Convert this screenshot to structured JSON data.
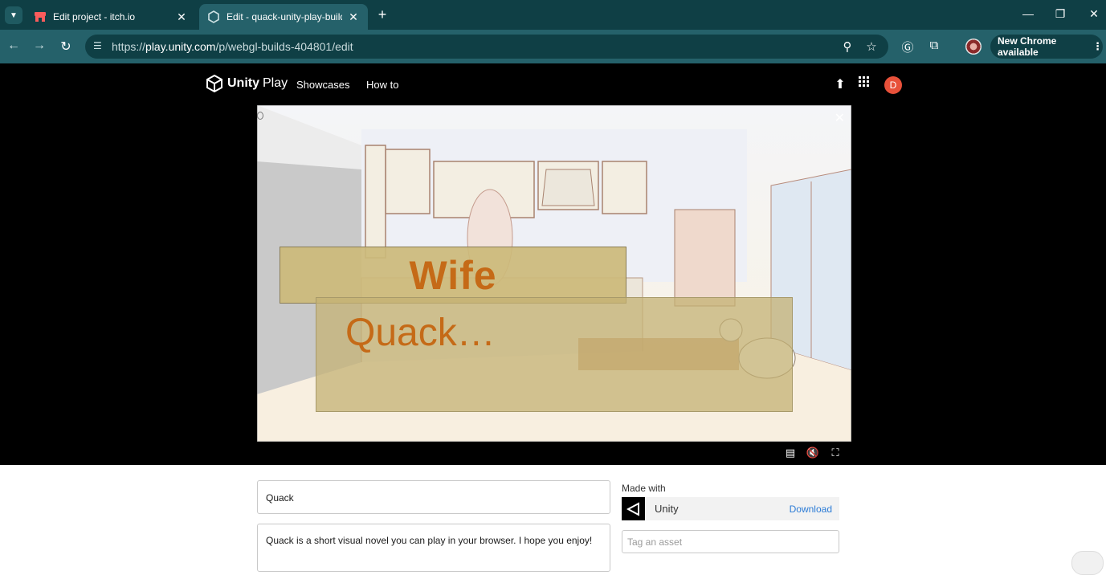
{
  "browser": {
    "tabs": [
      {
        "title": "Edit project - itch.io",
        "active": false
      },
      {
        "title": "Edit - quack-unity-play-build",
        "active": true
      }
    ],
    "url_prefix": "https://",
    "url_host": "play.unity.com",
    "url_path": "/p/webgl-builds-404801/edit",
    "update_button": "New Chrome available",
    "icons": {
      "tab_menu": "chevron-down-icon",
      "new_tab": "plus-icon",
      "minimize": "minimize-icon",
      "restore": "restore-icon",
      "close": "close-icon",
      "back": "arrow-left-icon",
      "forward": "arrow-right-icon",
      "reload": "reload-icon",
      "site_info": "tune-icon",
      "zoom": "zoom-icon",
      "bookmark": "star-icon",
      "grammarly": "grammarly-icon",
      "extensions": "puzzle-icon",
      "menu": "kebab-icon"
    }
  },
  "header": {
    "brand": "Unity",
    "brand_suffix": "Play",
    "nav": [
      "Showcases",
      "How to"
    ],
    "avatar_letter": "D",
    "accent": "#e8513a"
  },
  "game": {
    "speaker": "Wife",
    "dialog": "Quack…",
    "text_color": "#c56a17"
  },
  "player_controls": [
    "clapperboard-icon",
    "mute-icon",
    "fullscreen-icon"
  ],
  "form": {
    "title_value": "Quack",
    "description_value": "Quack is a short visual novel you can play in your browser. I hope you enjoy!",
    "made_with_label": "Made with",
    "engine_name": "Unity",
    "engine_download": "Download",
    "tag_placeholder": "Tag an asset"
  }
}
